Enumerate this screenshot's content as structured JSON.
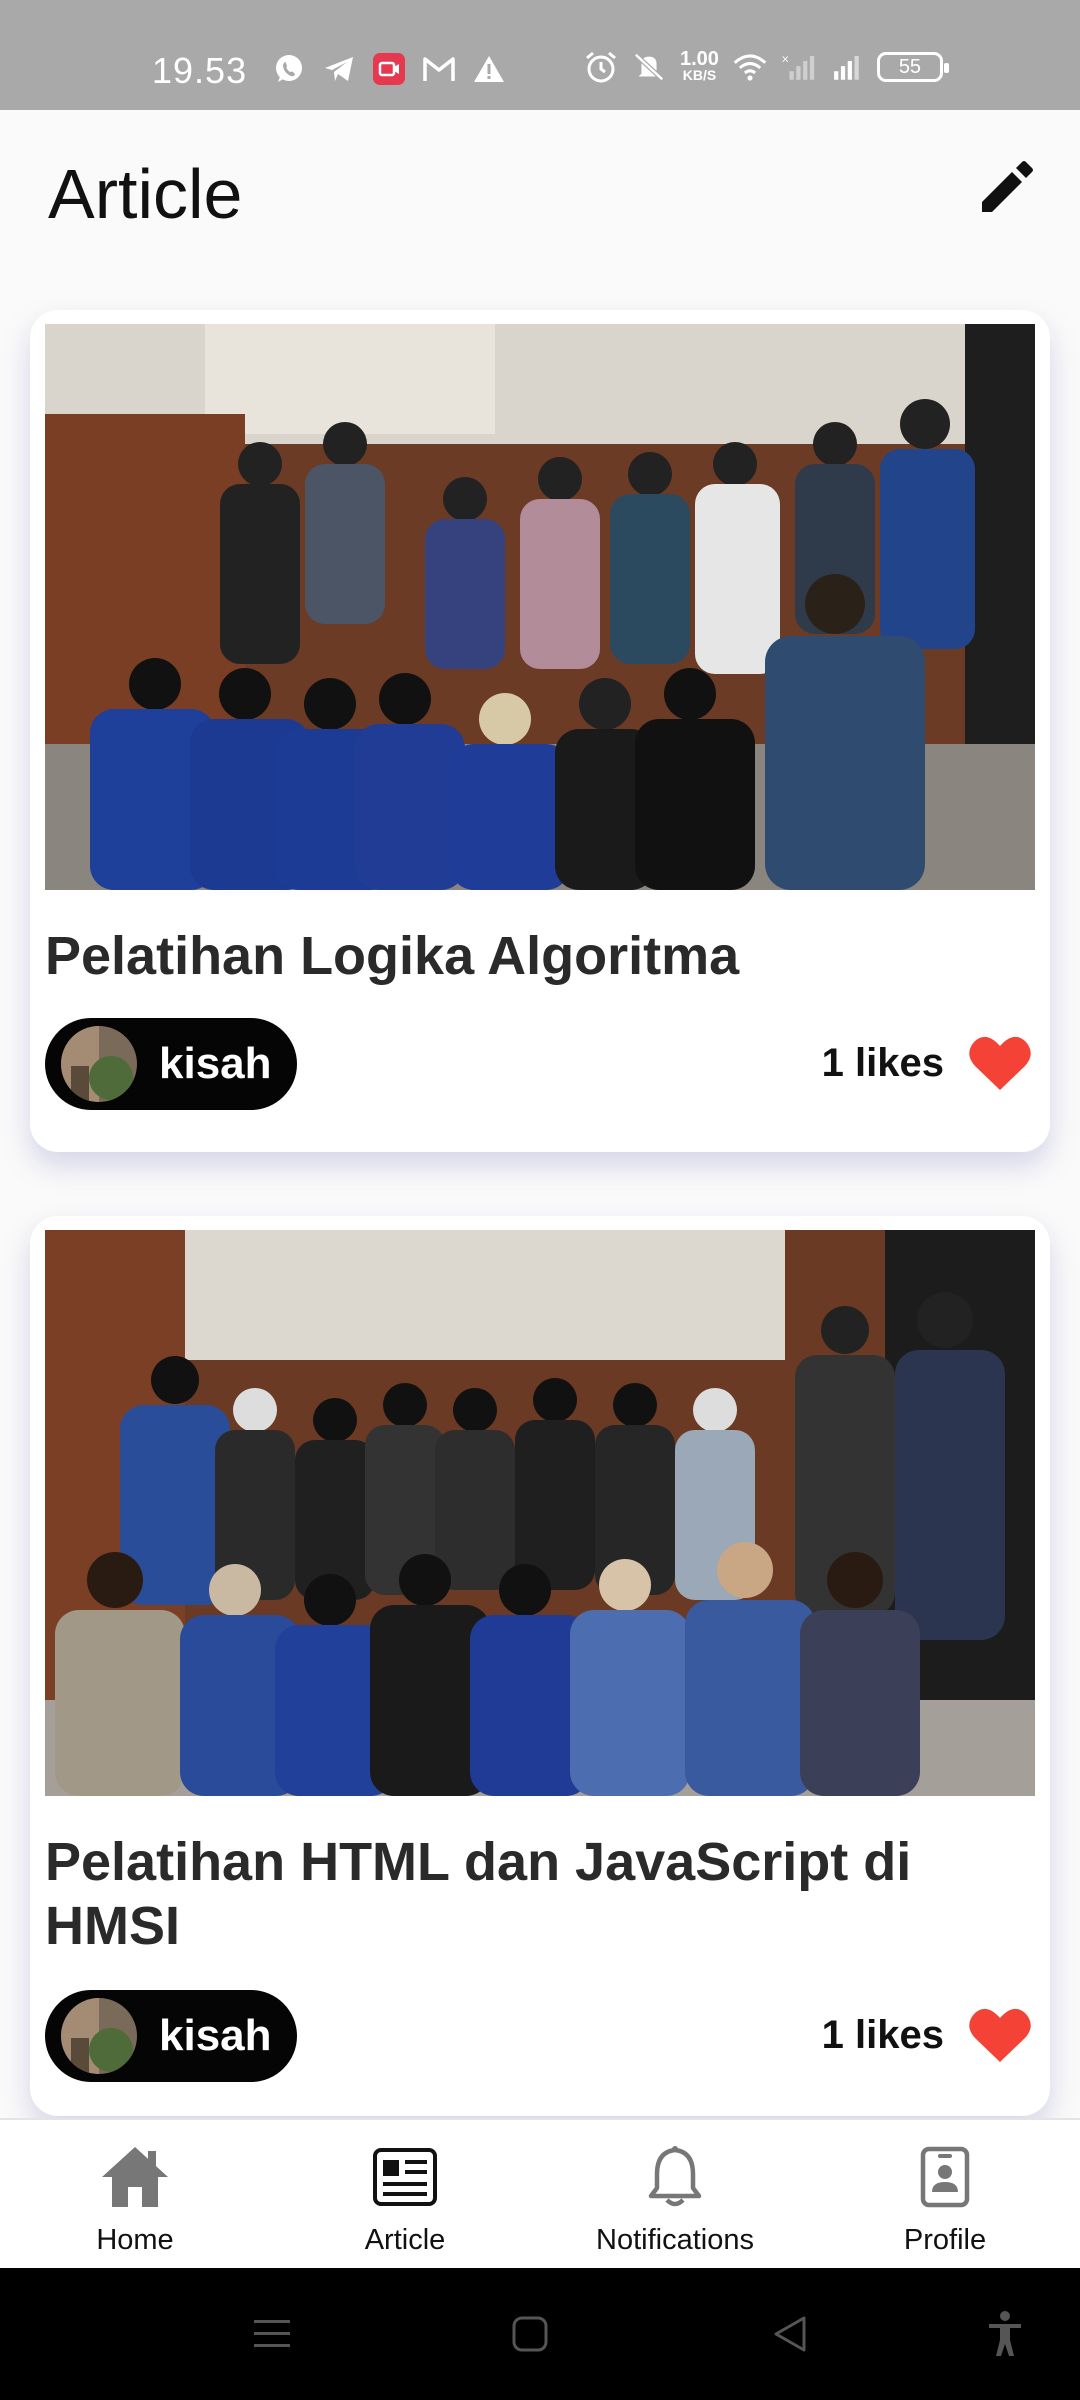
{
  "status_bar": {
    "time": "19.53",
    "speed_value": "1.00",
    "speed_unit": "KB/S",
    "battery": "55"
  },
  "header": {
    "title": "Article",
    "edit_icon": "pencil-icon"
  },
  "articles": [
    {
      "title": "Pelatihan Logika Algoritma",
      "author": "kisah",
      "likes": "1 likes",
      "liked": true
    },
    {
      "title": "Pelatihan HTML dan JavaScript di HMSI",
      "author": "kisah",
      "likes": "1 likes",
      "liked": true
    }
  ],
  "bottom_nav": {
    "items": [
      {
        "label": "Home",
        "icon": "home-icon"
      },
      {
        "label": "Article",
        "icon": "newspaper-icon",
        "active": true
      },
      {
        "label": "Notifications",
        "icon": "bell-icon"
      },
      {
        "label": "Profile",
        "icon": "profile-badge-icon"
      }
    ]
  },
  "colors": {
    "status_bar": "#a9a9a9",
    "heart": "#f44336",
    "chip": "#050505",
    "nav_inactive": "#777777",
    "nav_active": "#111111"
  }
}
